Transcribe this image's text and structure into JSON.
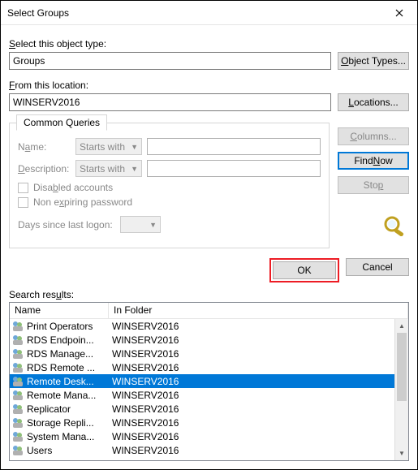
{
  "window": {
    "title": "Select Groups"
  },
  "labels": {
    "object_type": "Select this object type:",
    "from_location": "From this location:",
    "search_results": "Search results:",
    "common_queries": "Common Queries",
    "name": "Name:",
    "description": "Description:",
    "disabled_accounts": "Disabled accounts",
    "non_expiring": "Non expiring password",
    "days_since": "Days since last logon:"
  },
  "fields": {
    "object_type_value": "Groups",
    "location_value": "WINSERV2016",
    "name_mode": "Starts with",
    "desc_mode": "Starts with"
  },
  "buttons": {
    "object_types": "Object Types...",
    "locations": "Locations...",
    "columns": "Columns...",
    "find_now": "Find Now",
    "stop": "Stop",
    "ok": "OK",
    "cancel": "Cancel"
  },
  "columns": {
    "name": "Name",
    "folder": "In Folder"
  },
  "results": [
    {
      "name": "Print Operators",
      "folder": "WINSERV2016",
      "selected": false
    },
    {
      "name": "RDS Endpoin...",
      "folder": "WINSERV2016",
      "selected": false
    },
    {
      "name": "RDS Manage...",
      "folder": "WINSERV2016",
      "selected": false
    },
    {
      "name": "RDS Remote ...",
      "folder": "WINSERV2016",
      "selected": false
    },
    {
      "name": "Remote Desk...",
      "folder": "WINSERV2016",
      "selected": true
    },
    {
      "name": "Remote Mana...",
      "folder": "WINSERV2016",
      "selected": false
    },
    {
      "name": "Replicator",
      "folder": "WINSERV2016",
      "selected": false
    },
    {
      "name": "Storage Repli...",
      "folder": "WINSERV2016",
      "selected": false
    },
    {
      "name": "System Mana...",
      "folder": "WINSERV2016",
      "selected": false
    },
    {
      "name": "Users",
      "folder": "WINSERV2016",
      "selected": false
    }
  ]
}
